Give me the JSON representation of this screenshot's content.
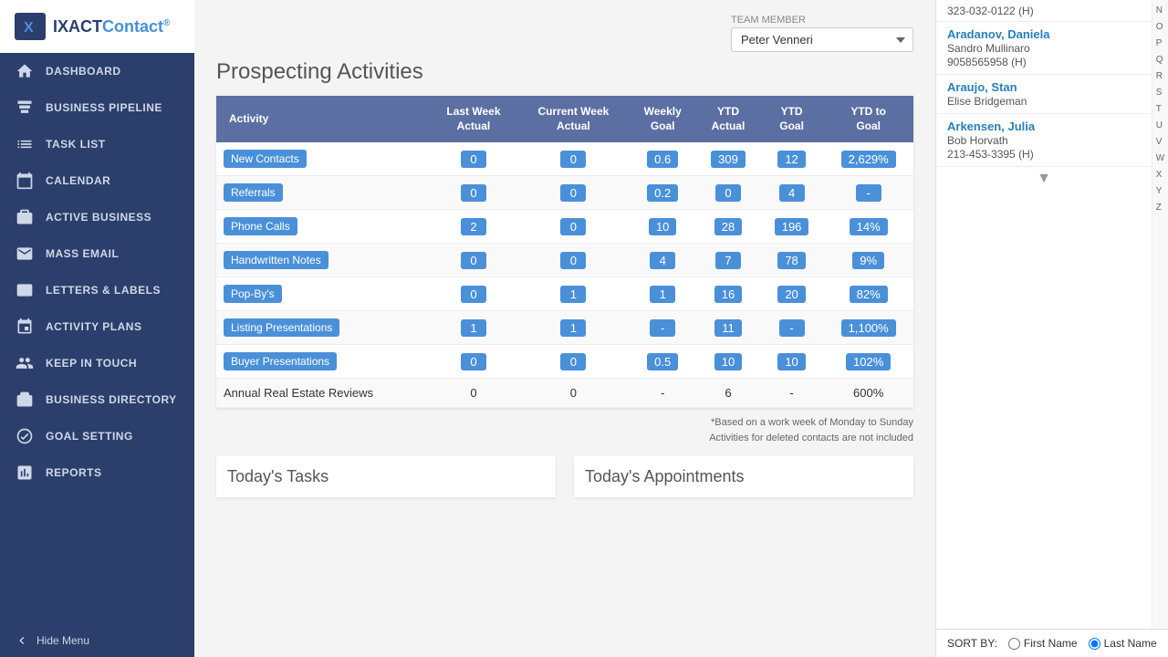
{
  "app": {
    "name": "IXACT Contact",
    "logo_icon": "X"
  },
  "sidebar": {
    "hide_menu_label": "Hide Menu",
    "items": [
      {
        "id": "dashboard",
        "label": "DASHBOARD",
        "icon": "home"
      },
      {
        "id": "business-pipeline",
        "label": "BUSINESS PIPELINE",
        "icon": "pipeline"
      },
      {
        "id": "task-list",
        "label": "TASK LIST",
        "icon": "tasks"
      },
      {
        "id": "calendar",
        "label": "CALENDAR",
        "icon": "calendar"
      },
      {
        "id": "active-business",
        "label": "ACTIVE BUSINESS",
        "icon": "briefcase"
      },
      {
        "id": "mass-email",
        "label": "MASS EMAIL",
        "icon": "email"
      },
      {
        "id": "letters-labels",
        "label": "LETTERS & LABELS",
        "icon": "letter"
      },
      {
        "id": "activity-plans",
        "label": "ACTIVITY PLANS",
        "icon": "plans"
      },
      {
        "id": "keep-in-touch",
        "label": "KEEP IN TOUCH",
        "icon": "touch"
      },
      {
        "id": "business-directory",
        "label": "BUSINESS DIRECTORY",
        "icon": "directory"
      },
      {
        "id": "goal-setting",
        "label": "GOAL SETTING",
        "icon": "goal"
      },
      {
        "id": "reports",
        "label": "REPORTS",
        "icon": "reports"
      }
    ]
  },
  "header": {
    "title": "Prospecting Activities",
    "team_member_label": "TEAM MEMBER",
    "team_member_value": "Peter Venneri",
    "team_member_options": [
      "Peter Venneri"
    ]
  },
  "table": {
    "columns": [
      "Activity",
      "Last Week Actual",
      "Current Week Actual",
      "Weekly Goal",
      "YTD Actual",
      "YTD Goal",
      "YTD to Goal"
    ],
    "rows": [
      {
        "activity": "New Contacts",
        "last_week": "0",
        "current_week": "0",
        "weekly_goal": "0.6",
        "ytd_actual": "309",
        "ytd_goal": "12",
        "ytd_to_goal": "2,629%",
        "highlighted": true
      },
      {
        "activity": "Referrals",
        "last_week": "0",
        "current_week": "0",
        "weekly_goal": "0.2",
        "ytd_actual": "0",
        "ytd_goal": "4",
        "ytd_to_goal": "-",
        "highlighted": true
      },
      {
        "activity": "Phone Calls",
        "last_week": "2",
        "current_week": "0",
        "weekly_goal": "10",
        "ytd_actual": "28",
        "ytd_goal": "196",
        "ytd_to_goal": "14%",
        "highlighted": true
      },
      {
        "activity": "Handwritten Notes",
        "last_week": "0",
        "current_week": "0",
        "weekly_goal": "4",
        "ytd_actual": "7",
        "ytd_goal": "78",
        "ytd_to_goal": "9%",
        "highlighted": true
      },
      {
        "activity": "Pop-By's",
        "last_week": "0",
        "current_week": "1",
        "weekly_goal": "1",
        "ytd_actual": "16",
        "ytd_goal": "20",
        "ytd_to_goal": "82%",
        "highlighted": true
      },
      {
        "activity": "Listing Presentations",
        "last_week": "1",
        "current_week": "1",
        "weekly_goal": "-",
        "ytd_actual": "11",
        "ytd_goal": "-",
        "ytd_to_goal": "1,100%",
        "highlighted": true
      },
      {
        "activity": "Buyer Presentations",
        "last_week": "0",
        "current_week": "0",
        "weekly_goal": "0.5",
        "ytd_actual": "10",
        "ytd_goal": "10",
        "ytd_to_goal": "102%",
        "highlighted": true
      },
      {
        "activity": "Annual Real Estate Reviews",
        "last_week": "0",
        "current_week": "0",
        "weekly_goal": "-",
        "ytd_actual": "6",
        "ytd_goal": "-",
        "ytd_to_goal": "600%",
        "highlighted": false
      }
    ],
    "footnote_line1": "*Based on a work week of Monday to Sunday",
    "footnote_line2": "Activities for deleted contacts are not included"
  },
  "bottom": {
    "tasks_title": "Today's Tasks",
    "appointments_title": "Today's Appointments"
  },
  "right_panel": {
    "alpha_letters": [
      "N",
      "O",
      "P",
      "Q",
      "R",
      "S",
      "T",
      "U",
      "V",
      "W",
      "X",
      "Y",
      "Z"
    ],
    "contacts": [
      {
        "id": "aradanov",
        "name": "Aradanov, Daniela",
        "line1": "Sandro Mullinaro",
        "line2": "9058565958 (H)"
      },
      {
        "id": "araujo",
        "name": "Araujo, Stan",
        "line1": "Elise Bridgeman",
        "line2": ""
      },
      {
        "id": "arkensen",
        "name": "Arkensen, Julia",
        "line1": "Bob Horvath",
        "line2": "213-453-3395 (H)"
      }
    ],
    "partial_top": "323-032-0122 (H)",
    "sort_by_label": "SORT BY:",
    "sort_options": [
      "First Name",
      "Last Name"
    ],
    "sort_selected": "Last Name"
  }
}
